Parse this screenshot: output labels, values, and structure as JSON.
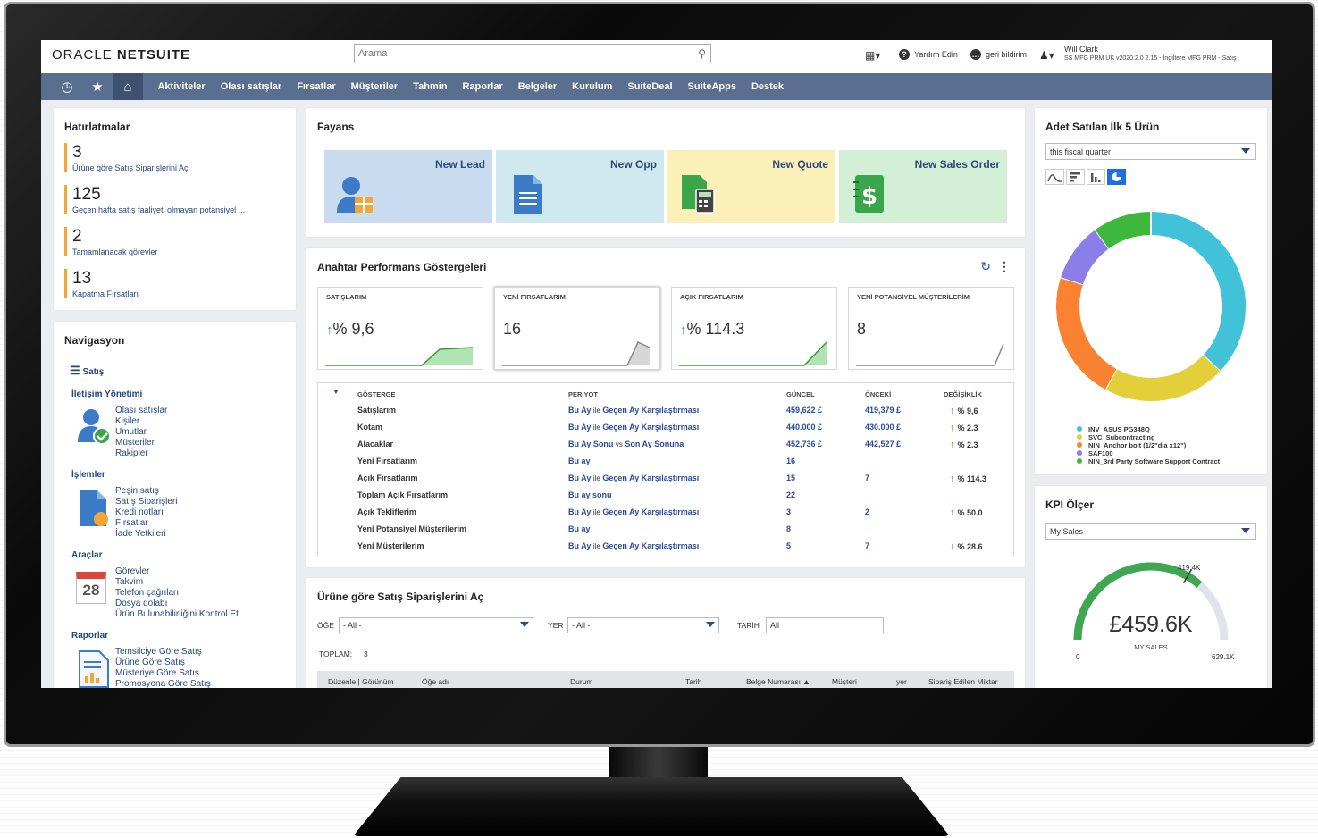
{
  "header": {
    "logo_brand": "ORACLE",
    "logo_product": "NETSUITE",
    "search_placeholder": "Arama",
    "help_label": "Yardım Edin",
    "feedback_label": "geri bildirim",
    "user_name": "Will Clark",
    "user_role": "SS MFG PRM UK v2020.2.0 2.15 - İngiltere MFG PRM - Satış"
  },
  "nav": {
    "items": [
      "Aktiviteler",
      "Olası satışlar",
      "Fırsatlar",
      "Müşteriler",
      "Tahmin",
      "Raporlar",
      "Belgeler",
      "Kurulum",
      "SuiteDeal",
      "SuiteApps",
      "Destek"
    ]
  },
  "reminders": {
    "title": "Hatırlatmalar",
    "items": [
      {
        "count": "3",
        "label": "Ürüne göre Satış Siparişlerini Aç"
      },
      {
        "count": "125",
        "label": "Geçen hafta satış faaliyeti olmayan potansiyel ..."
      },
      {
        "count": "2",
        "label": "Tamamlanacak görevler"
      },
      {
        "count": "13",
        "label": "Kapatma Fırsatları"
      }
    ]
  },
  "navigation": {
    "title": "Navigasyon",
    "menu_label": "Satış",
    "sections": [
      {
        "heading": "İletişim Yönetimi",
        "links": [
          "Olası satışlar",
          "Kişiler",
          "Umutlar",
          "Müşteriler",
          "Rakipler"
        ]
      },
      {
        "heading": "İşlemler",
        "links": [
          "Peşin satış",
          "Satış Siparişleri",
          "Kredi notları",
          "Fırsatlar",
          "İade Yetkileri"
        ]
      },
      {
        "heading": "Araçlar",
        "links": [
          "Görevler",
          "Takvim",
          "Telefon çağrıları",
          "Dosya dolabı",
          "Ürün Bulunabilirliğini Kontrol Et"
        ]
      },
      {
        "heading": "Raporlar",
        "links": [
          "Temsilciye Göre Satış",
          "Ürüne Göre Satış",
          "Müşteriye Göre Satış",
          "Promosyona Göre Satış"
        ]
      }
    ],
    "calendar_day": "28"
  },
  "tiles": {
    "title": "Fayans",
    "items": [
      {
        "label": "New Lead",
        "bg": "#c9dbef"
      },
      {
        "label": "New Opp",
        "bg": "#cfe9ef"
      },
      {
        "label": "New Quote",
        "bg": "#fbf0b8"
      },
      {
        "label": "New Sales Order",
        "bg": "#d3efd6"
      }
    ]
  },
  "kpi": {
    "title": "Anahtar Performans Göstergeleri",
    "cards": [
      {
        "label": "SATIŞLARIM",
        "arrow": "↑",
        "value": "% 9,6",
        "selected": false
      },
      {
        "label": "YENİ FIRSATLARIM",
        "arrow": "",
        "value": "16",
        "selected": true
      },
      {
        "label": "AÇIK FIRSATLARIM",
        "arrow": "↑",
        "value": "% 114.3",
        "selected": false
      },
      {
        "label": "YENİ POTANSİYEL MÜŞTERİLERİM",
        "arrow": "",
        "value": "8",
        "selected": false
      }
    ],
    "columns": [
      "GÖSTERGE",
      "PERİYOT",
      "GÜNCEL",
      "ÖNCEKİ",
      "DEĞİŞİKLİK"
    ],
    "rows": [
      {
        "name": "Satışlarım",
        "p1": "Bu Ay",
        "sep": "ile",
        "p2": "Geçen Ay Karşılaştırması",
        "current": "459,622 £",
        "previous": "419,379 £",
        "dir": "up",
        "change": "% 9,6"
      },
      {
        "name": "Kotam",
        "p1": "Bu Ay",
        "sep": "ile",
        "p2": "Geçen Ay Karşılaştırması",
        "current": "440.000 £",
        "previous": "430.000 £",
        "dir": "up",
        "change": "% 2.3"
      },
      {
        "name": "Alacaklar",
        "p1": "Bu Ay Sonu",
        "sep": "vs",
        "p2": "Son Ay Sonuna",
        "current": "452,736 £",
        "previous": "442,527 £",
        "dir": "up",
        "change": "% 2.3"
      },
      {
        "name": "Yeni Fırsatlarım",
        "p1": "Bu ay",
        "sep": "",
        "p2": "",
        "current": "16",
        "previous": "",
        "dir": "",
        "change": ""
      },
      {
        "name": "Açık Fırsatlarım",
        "p1": "Bu Ay",
        "sep": "ile",
        "p2": "Geçen Ay Karşılaştırması",
        "current": "15",
        "previous": "7",
        "dir": "up",
        "change": "% 114.3"
      },
      {
        "name": "Toplam Açık Fırsatlarım",
        "p1": "Bu ay sonu",
        "sep": "",
        "p2": "",
        "current": "22",
        "previous": "",
        "dir": "",
        "change": ""
      },
      {
        "name": "Açık Tekliflerim",
        "p1": "Bu Ay",
        "sep": "ile",
        "p2": "Geçen Ay Karşılaştırması",
        "current": "3",
        "previous": "2",
        "dir": "up",
        "change": "% 50.0"
      },
      {
        "name": "Yeni Potansiyel Müşterilerim",
        "p1": "Bu ay",
        "sep": "",
        "p2": "",
        "current": "8",
        "previous": "",
        "dir": "",
        "change": ""
      },
      {
        "name": "Yeni Müşterilerim",
        "p1": "Bu Ay",
        "sep": "ile",
        "p2": "Geçen Ay Karşılaştırması",
        "current": "5",
        "previous": "7",
        "dir": "down",
        "change": "% 28.6"
      }
    ]
  },
  "orders": {
    "title": "Ürüne göre Satış Siparişlerini Aç",
    "filter_item_label": "ÖĞE",
    "filter_item_value": "- All -",
    "filter_place_label": "YER",
    "filter_place_value": "- All -",
    "filter_date_label": "TARİH",
    "filter_date_value": "All",
    "total_label": "TOPLAM:",
    "total_value": "3",
    "columns": [
      "Düzenle | Görünüm",
      "Öğe adı",
      "Durum",
      "Tarih",
      "Belge Numarası ▲",
      "Müşteri",
      "yer",
      "Sipariş Edilen Miktar"
    ]
  },
  "top_products": {
    "title": "Adet Satılan İlk 5 Ürün",
    "period": "this fiscal quarter",
    "chart_data": {
      "type": "pie",
      "categories": [
        "INV_ASUS PG348Q",
        "SVC_Subcontracting",
        "NIN_Anchor bolt (1/2\"dia x12\")",
        "SAF100",
        "NIN_3rd Party Software Support Contract"
      ],
      "values": [
        37,
        21,
        22,
        10,
        10
      ],
      "colors": [
        "#42c2d9",
        "#e3cf3a",
        "#fb8230",
        "#8b7ee8",
        "#3db83d"
      ]
    }
  },
  "kpi_meter": {
    "title": "KPI Ölçer",
    "selected": "My Sales",
    "value_label": "£459.6K",
    "sub_label": "MY SALES",
    "min_label": "0",
    "target_label": "419.4K",
    "max_label": "629.1K",
    "gauge_fraction": 0.7306
  }
}
